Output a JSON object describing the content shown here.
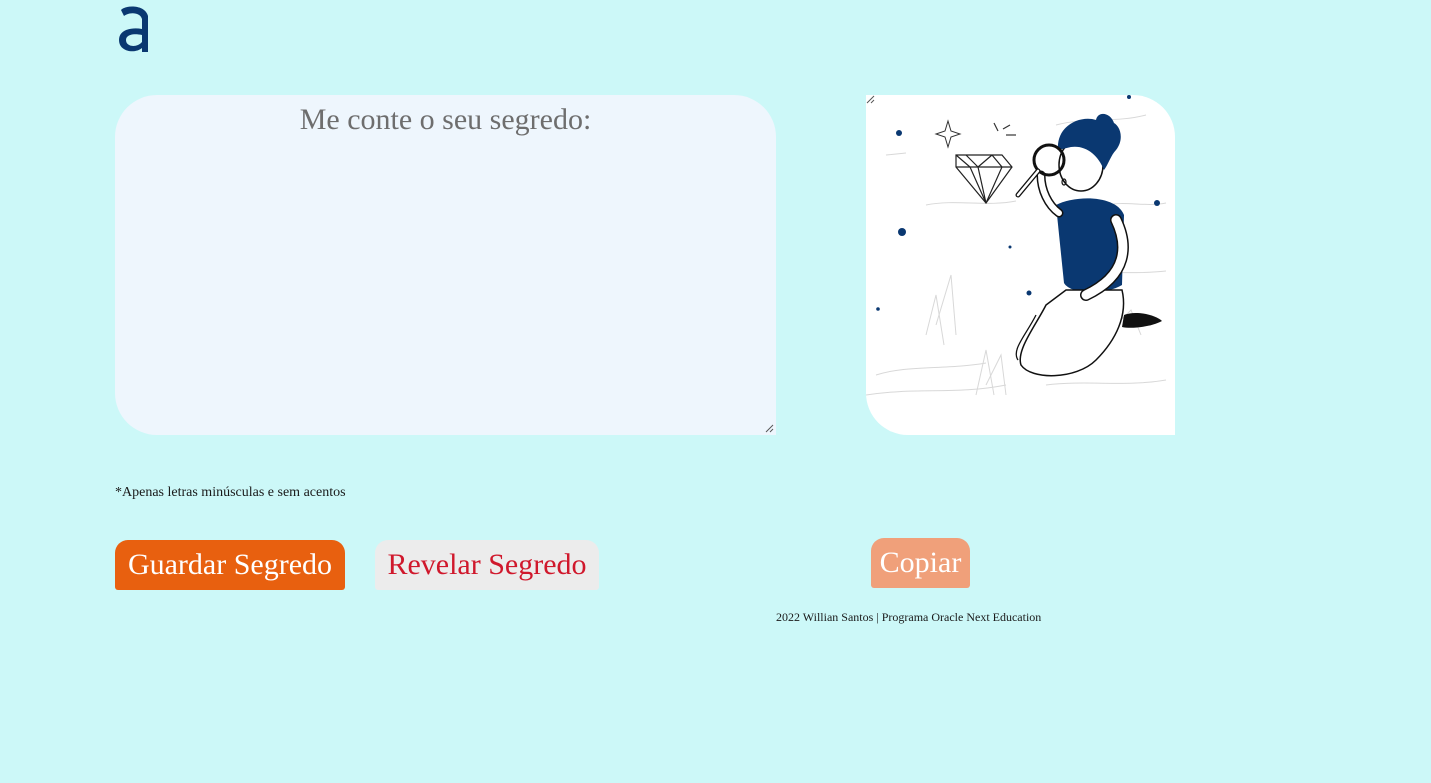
{
  "logo": {
    "icon": "alura-a-logo",
    "color": "#0a3871"
  },
  "input": {
    "placeholder": "Me conte o seu segredo:",
    "value": ""
  },
  "output": {
    "image": "person-magnifying-glass-illustration",
    "accent_color": "#0a3871"
  },
  "hint_text": "*Apenas letras minúsculas e sem acentos",
  "buttons": {
    "encrypt_label": "Guardar Segredo",
    "decrypt_label": "Revelar Segredo",
    "copy_label": "Copiar"
  },
  "colors": {
    "background": "#ccf8f8",
    "encrypt_bg": "#e8600f",
    "decrypt_text": "#d0182c",
    "copy_bg": "#f0a07a"
  },
  "footer_text": "2022 Willian Santos | Programa Oracle Next Education"
}
